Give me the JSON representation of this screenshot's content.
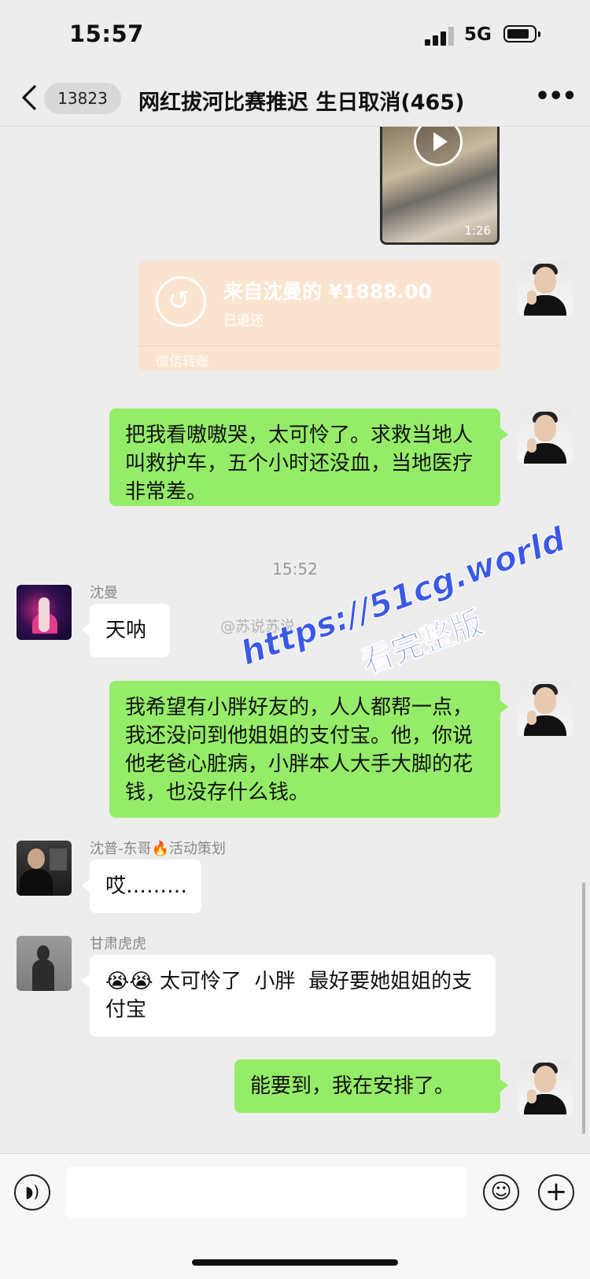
{
  "status": {
    "time": "15:57",
    "network": "5G"
  },
  "nav": {
    "badge": "13823",
    "title": "网红拔河比赛推迟 生日取消(465)"
  },
  "video": {
    "duration": "1:26"
  },
  "transfer": {
    "amount": "来自沈曼的 ¥1888.00",
    "status": "已退还",
    "label": "微信转账"
  },
  "messages": {
    "m1": "把我看嗷嗷哭，太可怜了。求救当地人叫救护车，五个小时还没血，当地医疗非常差。",
    "timestamp": "15:52",
    "shenman_name": "沈曼",
    "shenman_text": "天呐",
    "m2": "我希望有小胖好友的，人人都帮一点，我还没问到他姐姐的支付宝。他，你说他老爸心脏病，小胖本人大手大脚的花钱，也没存什么钱。",
    "dongge_name": "沈普-东哥🔥活动策划",
    "dongge_text": "哎………",
    "gansu_name": "甘肃虎虎",
    "gansu_text": "😭😭 太可怜了  小胖  最好要她姐姐的支付宝",
    "m3": "能要到，我在安排了。"
  },
  "watermark": {
    "weibo": "@苏说苏说",
    "url": "https://51cg.world",
    "sub": "看完整版"
  }
}
